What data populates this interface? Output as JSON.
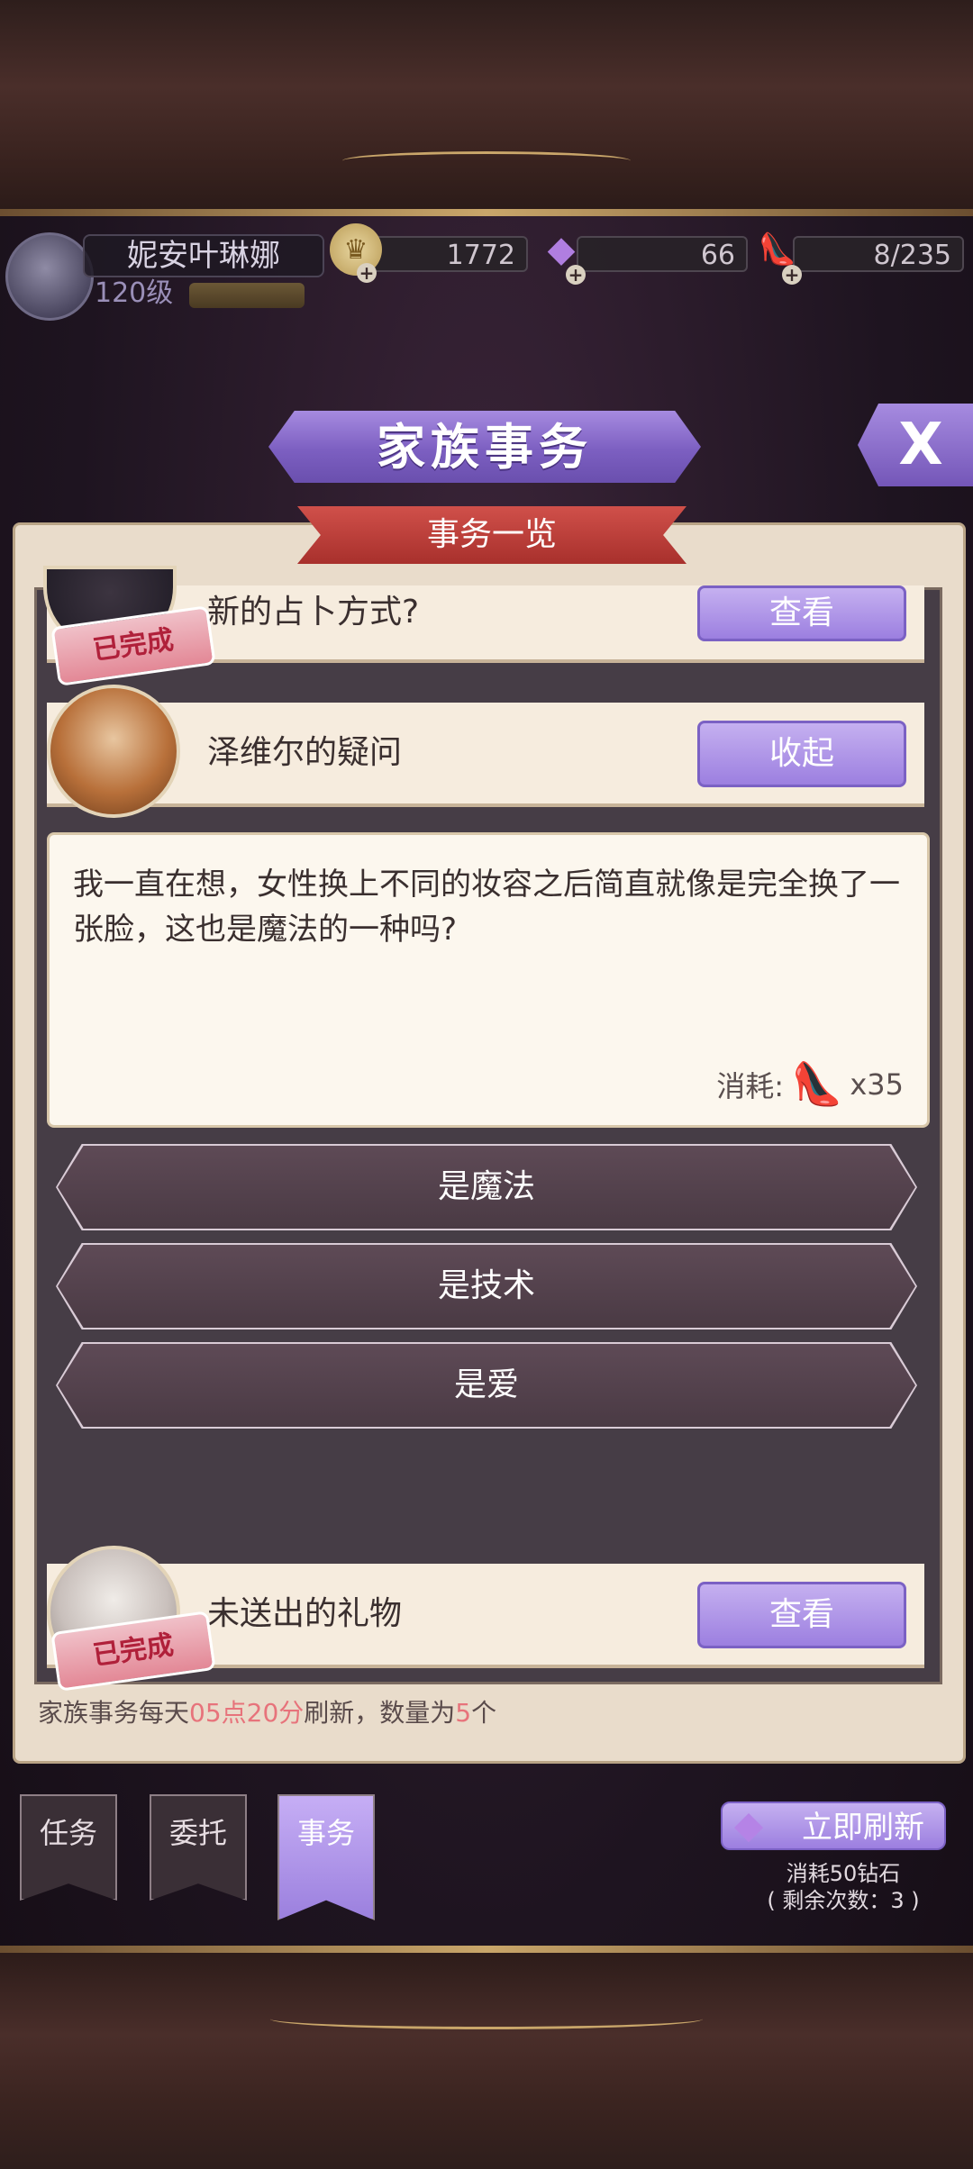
{
  "player": {
    "name": "妮安叶琳娜",
    "level": "120级"
  },
  "resources": {
    "coins": "1772",
    "gems": "66",
    "slippers": "8/235"
  },
  "header": {
    "title": "家族事务",
    "close_label": "X",
    "subtitle": "事务一览"
  },
  "tasks": [
    {
      "title": "新的占卜方式?",
      "button": "查看",
      "status": "已完成"
    },
    {
      "title": "泽维尔的疑问",
      "button": "收起"
    },
    {
      "title": "未送出的礼物",
      "button": "查看",
      "status": "已完成"
    }
  ],
  "detail": {
    "text": "我一直在想，女性换上不同的妆容之后简直就像是完全换了一张脸，这也是魔法的一种吗?",
    "cost_label": "消耗:",
    "cost_value": "x35",
    "options": [
      "是魔法",
      "是技术",
      "是爱"
    ]
  },
  "footer_note": {
    "prefix": "家族事务每天",
    "time": "05点20分",
    "middle": "刷新，数量为",
    "count": "5",
    "suffix": "个"
  },
  "tabs": [
    "任务",
    "委托",
    "事务"
  ],
  "refresh": {
    "label": "立即刷新",
    "cost": "消耗50钻石",
    "remaining": "( 剩余次数：3 )"
  },
  "colors": {
    "accent_purple": "#9c7fe0",
    "banner_red": "#b8383a",
    "highlight": "#e7737b"
  }
}
